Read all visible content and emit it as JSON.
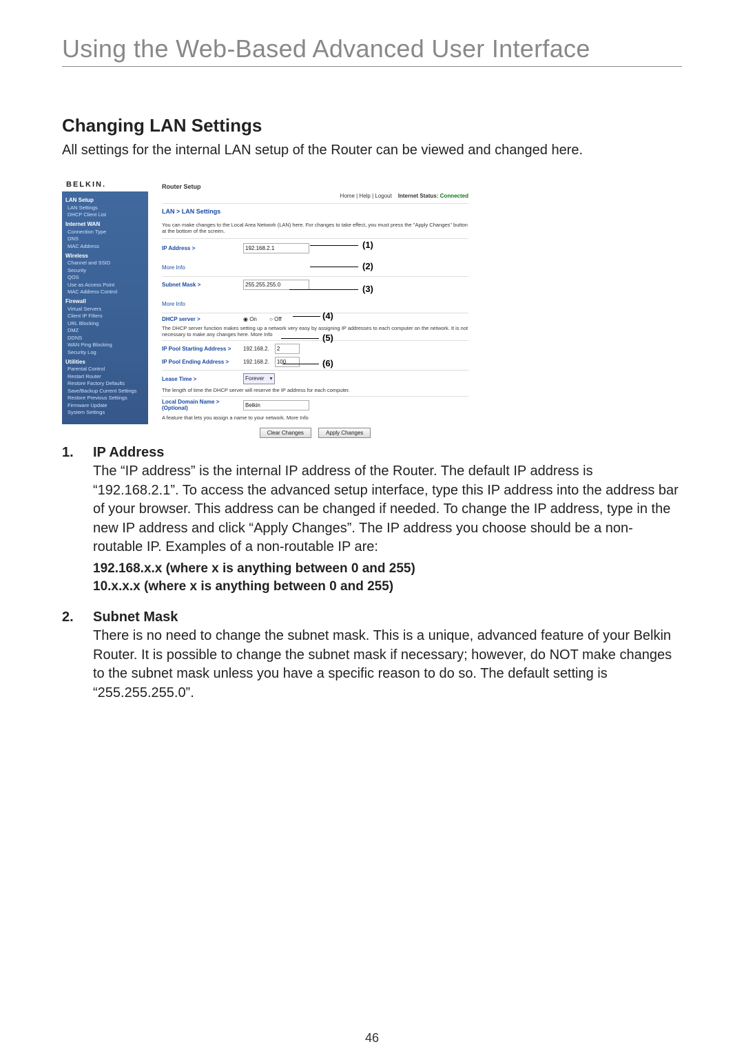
{
  "doc": {
    "page_title": "Using the Web-Based Advanced User Interface",
    "page_number": "46",
    "section_head": "Changing LAN Settings",
    "section_intro": "All settings for the internal LAN setup of the Router can be viewed and changed here."
  },
  "router": {
    "logo": "BELKIN.",
    "setup_label": "Router Setup",
    "topnav": "Home | Help | Logout",
    "status_label": "Internet Status:",
    "status_value": "Connected",
    "breadcrumb": "LAN > LAN Settings",
    "hint": "You can make changes to the Local Area Network (LAN) here. For changes to take effect, you must press the \"Apply Changes\" button at the bottom of the screen.",
    "ip_label": "IP Address >",
    "ip_value": "192.168.2.1",
    "more_info": "More Info",
    "subnet_label": "Subnet Mask >",
    "subnet_value": "255.255.255.0",
    "dhcp_label": "DHCP server >",
    "dhcp_on": "On",
    "dhcp_off": "Off",
    "dhcp_hint": "The DHCP server function makes setting up a network very easy by assigning IP addresses to each computer on the network. It is not necessary to make any changes here. More Info",
    "pool_start_label": "IP Pool Starting Address >",
    "pool_start_prefix": "192.168.2.",
    "pool_start_val": "2",
    "pool_end_label": "IP Pool Ending Address >",
    "pool_end_prefix": "192.168.2.",
    "pool_end_val": "100",
    "lease_label": "Lease Time >",
    "lease_value": "Forever",
    "lease_hint": "The length of time the DHCP server will reserve the IP address for each computer.",
    "domain_label": "Local Domain Name > (Optional)",
    "domain_value": "Belkin",
    "domain_hint": "A feature that lets you assign a name to your network. More Info",
    "btn_clear": "Clear Changes",
    "btn_apply": "Apply Changes",
    "sidebar": {
      "g1": "LAN Setup",
      "g1_items": [
        "LAN Settings",
        "DHCP Client List"
      ],
      "g2": "Internet WAN",
      "g2_items": [
        "Connection Type",
        "DNS",
        "MAC Address"
      ],
      "g3": "Wireless",
      "g3_items": [
        "Channel and SSID",
        "Security",
        "QOS",
        "Use as Access Point",
        "MAC Address Control"
      ],
      "g4": "Firewall",
      "g4_items": [
        "Virtual Servers",
        "Client IP Filters",
        "URL Blocking",
        "DMZ",
        "DDNS",
        "WAN Ping Blocking",
        "Security Log"
      ],
      "g5": "Utilities",
      "g5_items": [
        "Parental Control",
        "Restart Router",
        "Restore Factory Defaults",
        "Save/Backup Current Settings",
        "Restore Previous Settings",
        "Firmware Update",
        "System Settings"
      ]
    },
    "callouts": {
      "c1": "(1)",
      "c2": "(2)",
      "c3": "(3)",
      "c4": "(4)",
      "c5": "(5)",
      "c6": "(6)"
    }
  },
  "explain": {
    "item1_num": "1.",
    "item1_head": "IP Address",
    "item1_body": "The “IP address” is the internal IP address of the Router. The default IP address is “192.168.2.1”. To access the advanced setup interface, type this IP address into the address bar of your browser. This address can be changed if needed. To change the IP address, type in the new IP address and click “Apply Changes”. The IP address you choose should be a non-routable IP. Examples of a non-routable IP are:",
    "item1_sub1": "192.168.x.x (where x is anything between 0 and 255)",
    "item1_sub2": "10.x.x.x (where x is anything between 0 and 255)",
    "item2_num": "2.",
    "item2_head": "Subnet Mask",
    "item2_body": "There is no need to change the subnet mask. This is a unique, advanced feature of your Belkin Router. It is possible to change the subnet mask if necessary; however, do NOT make changes to the subnet mask unless you have a specific reason to do so. The default setting is “255.255.255.0”."
  }
}
